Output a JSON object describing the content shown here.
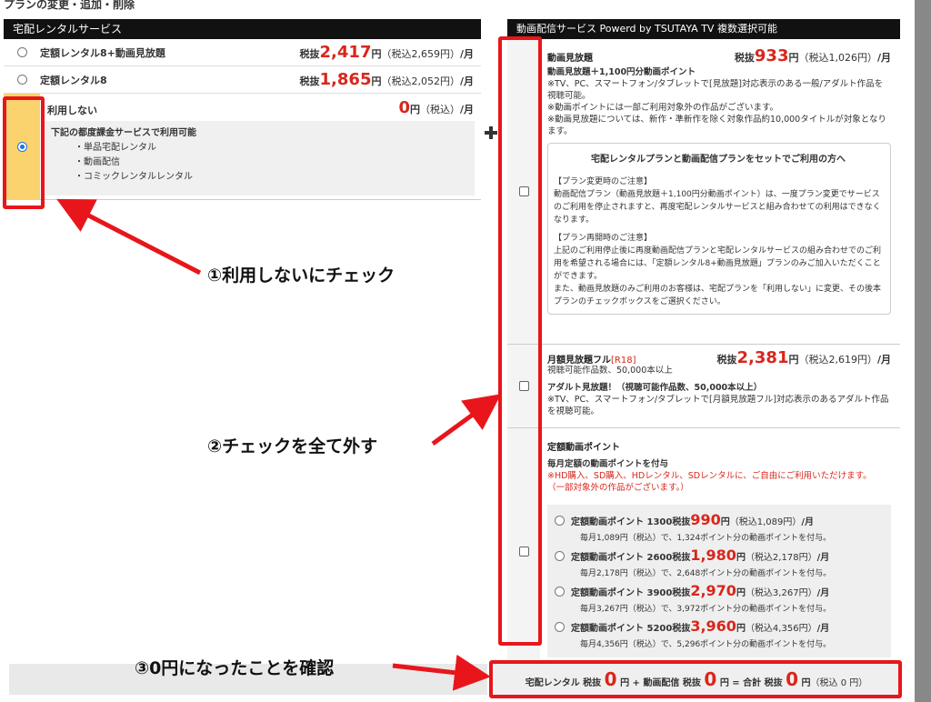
{
  "page": {
    "title": "プランの変更・追加・削除"
  },
  "rental": {
    "header": "宅配レンタルサービス",
    "plans": [
      {
        "name": "定額レンタル8+動画見放題",
        "pre": "税抜",
        "price": "2,417",
        "unit": "円",
        "tax": "（税込2,659円）",
        "per": "/月",
        "selected": false
      },
      {
        "name": "定額レンタル8",
        "pre": "税抜",
        "price": "1,865",
        "unit": "円",
        "tax": "（税込2,052円）",
        "per": "/月",
        "selected": false
      }
    ],
    "none": {
      "name": "利用しない",
      "price": "0",
      "unit": "円",
      "tax": "（税込）",
      "per": "/月",
      "selected": true,
      "box_title": "下記の都度課金サービスで利用可能",
      "items": [
        "・単品宅配レンタル",
        "・動画配信",
        "・コミックレンタルレンタル"
      ]
    }
  },
  "streaming": {
    "header": "動画配信サービス Powerd by TSUTAYA TV 複数選択可能",
    "mihodai": {
      "name": "動画見放題",
      "pre": "税抜",
      "price": "933",
      "unit": "円",
      "tax": "（税込1,026円）",
      "per": "/月",
      "highlight": "動画見放題＋1,100円分動画ポイント",
      "desc": [
        "※TV、PC、スマートフォン/タブレットで[見放題]対応表示のある一般/アダルト作品を視聴可能。",
        "※動画ポイントには一部ご利用対象外の作品がございます。",
        "※動画見放題については、新作・準新作を除く対象作品約10,000タイトルが対象となります。"
      ],
      "notice_title": "宅配レンタルプランと動画配信プランをセットでご利用の方へ",
      "notice_1_head": "【プラン変更時のご注意】",
      "notice_1_body": "動画配信プラン（動画見放題＋1,100円分動画ポイント）は、一度プラン変更でサービスのご利用を停止されますと、再度宅配レンタルサービスと組み合わせての利用はできなくなります。",
      "notice_2_head": "【プラン再開時のご注意】",
      "notice_2_body": "上記のご利用停止後に再度動画配信プランと宅配レンタルサービスの組み合わせでのご利用を希望される場合には、「定額レンタル8+動画見放題」プランのみご加入いただくことができます。",
      "notice_2_extra": "また、動画見放題のみご利用のお客様は、宅配プランを「利用しない」に変更、その後本プランのチェックボックスをご選択ください。",
      "checked": false
    },
    "full": {
      "name": "月額見放題フル",
      "tag": "[R18]",
      "pre": "税抜",
      "price": "2,381",
      "unit": "円",
      "tax": "（税込2,619円）",
      "per": "/月",
      "sub": "視聴可能作品数、50,000本以上",
      "highlight": "アダルト見放題！（視聴可能作品数、50,000本以上）",
      "desc": "※TV、PC、スマートフォン/タブレットで[月額見放題フル]対応表示のあるアダルト作品を視聴可能。",
      "checked": false
    },
    "points": {
      "name": "定額動画ポイント",
      "highlight": "毎月定額の動画ポイントを付与",
      "desc": "※HD購入、SD購入、HDレンタル、SDレンタルに、ご自由にご利用いただけます。",
      "desc2": "（一部対象外の作品がございます。）",
      "checked": false,
      "options": [
        {
          "name": "定額動画ポイント 1300",
          "pre": "税抜",
          "price": "990",
          "unit": "円",
          "tax": "（税込1,089円）",
          "per": "/月",
          "sub": "毎月1,089円（税込）で、1,324ポイント分の動画ポイントを付与。"
        },
        {
          "name": "定額動画ポイント 2600",
          "pre": "税抜",
          "price": "1,980",
          "unit": "円",
          "tax": "（税込2,178円）",
          "per": "/月",
          "sub": "毎月2,178円（税込）で、2,648ポイント分の動画ポイントを付与。"
        },
        {
          "name": "定額動画ポイント 3900",
          "pre": "税抜",
          "price": "2,970",
          "unit": "円",
          "tax": "（税込3,267円）",
          "per": "/月",
          "sub": "毎月3,267円（税込）で、3,972ポイント分の動画ポイントを付与。"
        },
        {
          "name": "定額動画ポイント 5200",
          "pre": "税抜",
          "price": "3,960",
          "unit": "円",
          "tax": "（税込4,356円）",
          "per": "/月",
          "sub": "毎月4,356円（税込）で、5,296ポイント分の動画ポイントを付与。"
        }
      ]
    }
  },
  "summary": {
    "rental_label": "宅配レンタル 税抜",
    "rental_value": "0",
    "yen_plus": "円 +",
    "stream_label": "動画配信 税抜",
    "stream_value": "0",
    "yen_eq": "円 =",
    "total_label": "合計 税抜",
    "total_value": "0",
    "yen": "円",
    "total_tax": "（税込 0 円）"
  },
  "annotations": {
    "step1": "①利用しないにチェック",
    "step2": "②チェックを全て外す",
    "step3": "③0円になったことを確認"
  },
  "colors": {
    "accent_red": "#d9261c",
    "annotation_red": "#e8161b",
    "selected_yellow": "#fbd36e",
    "header_black": "#111111"
  }
}
